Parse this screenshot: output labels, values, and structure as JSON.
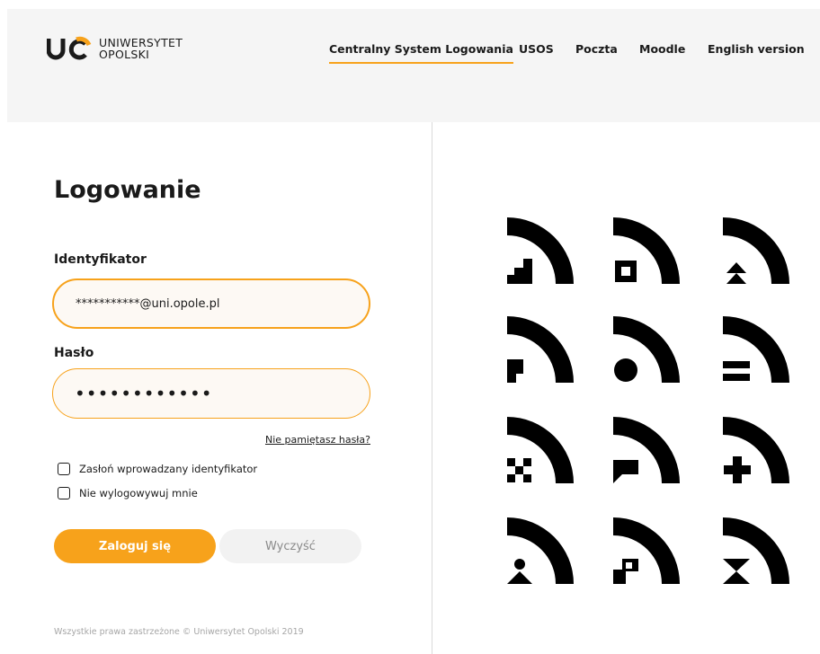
{
  "header": {
    "logo": {
      "line1": "UNIWERSYTET",
      "line2": "OPOLSKI",
      "mark": "UO"
    },
    "nav": [
      {
        "label": "Centralny System Logowania",
        "active": true
      },
      {
        "label": "USOS",
        "active": false
      },
      {
        "label": "Poczta",
        "active": false
      },
      {
        "label": "Moodle",
        "active": false
      },
      {
        "label": "English version",
        "active": false
      }
    ]
  },
  "form": {
    "title": "Logowanie",
    "identifier_label": "Identyfikator",
    "identifier_value": "***********@uni.opole.pl",
    "password_label": "Hasło",
    "password_value": "••••••••••••",
    "forgot_link": "Nie pamiętasz hasła?",
    "checkboxes": [
      {
        "label": "Zasłoń wprowadzany identyfikator",
        "checked": false
      },
      {
        "label": "Nie wylogowywuj mnie",
        "checked": false
      }
    ],
    "login_button": "Zaloguj się",
    "clear_button": "Wyczyść"
  },
  "footer": "Wszystkie prawa zastrzeżone © Uniwersytet Opolski 2019",
  "colors": {
    "accent": "#f7a21b",
    "text": "#1a1a1a",
    "header_bg": "#f5f5f5"
  },
  "pattern_icons": [
    "stairs",
    "square",
    "double-chevron",
    "speech-dot",
    "circle",
    "equals",
    "checker",
    "speech-flag",
    "plus",
    "person",
    "checker-step",
    "hourglass"
  ]
}
